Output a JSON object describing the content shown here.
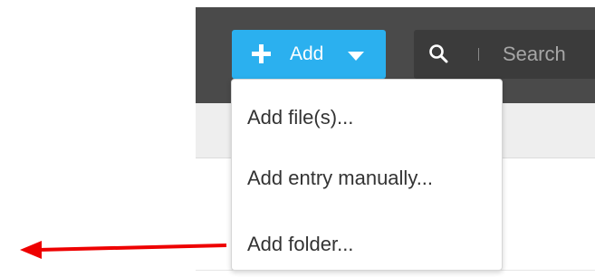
{
  "toolbar": {
    "add_button_label": "Add",
    "search_placeholder": "Search"
  },
  "dropdown": {
    "items": [
      {
        "label": "Add file(s)..."
      },
      {
        "label": "Add entry manually..."
      },
      {
        "label": "Add folder..."
      }
    ]
  },
  "icons": {
    "add": "plus-icon",
    "caret": "caret-down-icon",
    "search": "search-icon",
    "annotation": "arrow-left-icon"
  },
  "colors": {
    "toolbar_bg": "#4a4a4a",
    "accent": "#2bb0ef",
    "search_bg": "#3b3b3b",
    "annotation": "#ee0000"
  }
}
